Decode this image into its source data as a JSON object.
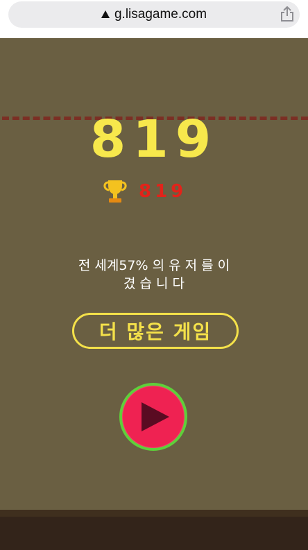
{
  "browser": {
    "url": "g.lisagame.com",
    "lock_icon": "warning-triangle-icon",
    "share_icon": "share-icon"
  },
  "game": {
    "score": "819",
    "best_score": "819",
    "beat_text": "전 세계57% 의 유 저 를 이\n겼 습 니 다",
    "more_games_label": "더 많은 게임",
    "play_icon": "play-icon",
    "trophy_icon": "trophy-icon"
  },
  "colors": {
    "background": "#6a5f42",
    "score": "#f7e84c",
    "best_score": "#e2231a",
    "dash_line": "#7b2f24",
    "play_fill": "#ef2252",
    "play_ring": "#5ed03a",
    "ground": "#33241a"
  }
}
